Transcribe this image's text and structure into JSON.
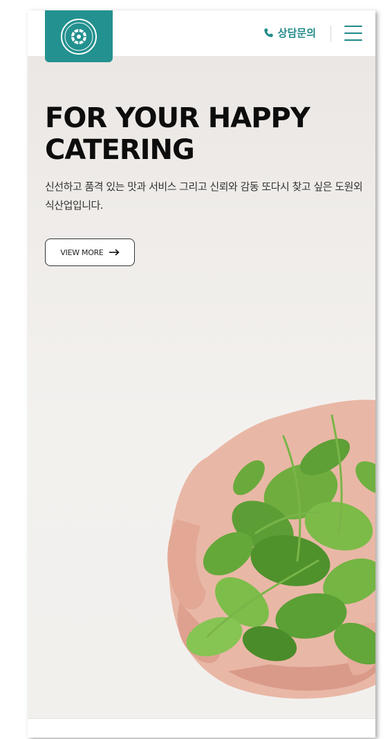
{
  "header": {
    "logo_icon": "company-emblem-icon",
    "contact_label": "상담문의",
    "contact_icon": "phone-icon",
    "menu_icon": "hamburger-menu-icon",
    "accent_color": "#23918f"
  },
  "hero": {
    "title_line1": "FOR YOUR HAPPY",
    "title_line2": "CATERING",
    "description": "신선하고 품격 있는 맛과 서비스 그리고 신뢰와 감동 또다시 찾고 싶은 도원외식산업입니다.",
    "button_label": "VIEW MORE",
    "button_icon": "arrow-right-icon",
    "image": "hands-holding-basil-leaves"
  }
}
